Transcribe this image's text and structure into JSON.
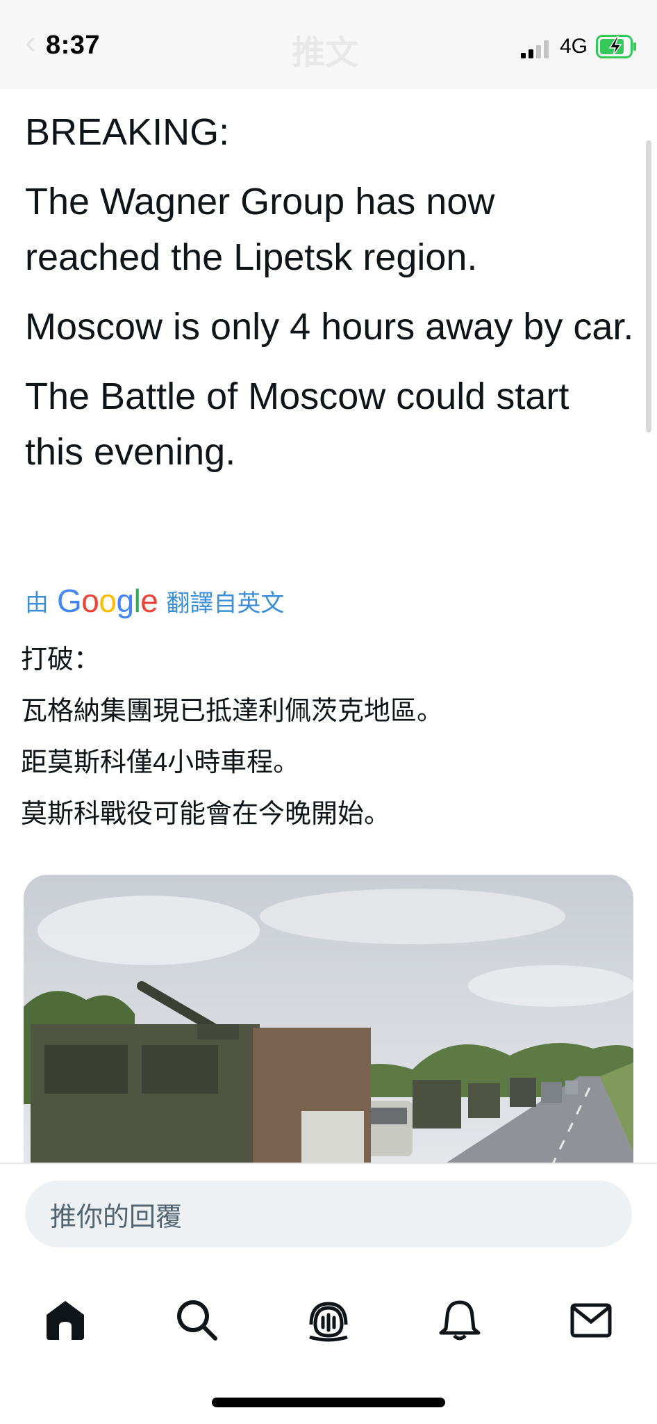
{
  "status_bar": {
    "time": "8:37",
    "network": "4G",
    "nav_title": "推文"
  },
  "tweet": {
    "lines": [
      "BREAKING:",
      "The Wagner Group has now reached the Lipetsk region.",
      "Moscow is only 4 hours away by car.",
      "The Battle of Moscow could start this evening."
    ]
  },
  "translation": {
    "prefix": "由",
    "provider": "Google",
    "suffix": "翻譯自英文",
    "lines": [
      "打破：",
      "瓦格納集團現已抵達利佩茨克地區。",
      "距莫斯科僅4小時車程。",
      "莫斯科戰役可能會在今晚開始。"
    ]
  },
  "media": {
    "description_icon": "photo-military-convoy"
  },
  "reply": {
    "placeholder": "推你的回覆"
  },
  "tab_bar": {
    "items": [
      "home-icon",
      "search-icon",
      "spaces-icon",
      "notifications-icon",
      "messages-icon"
    ]
  },
  "colors": {
    "translate_link": "#3b8ed8",
    "text": "#0f1419",
    "reply_bg": "#eef1f3",
    "battery_green": "#34c759"
  }
}
